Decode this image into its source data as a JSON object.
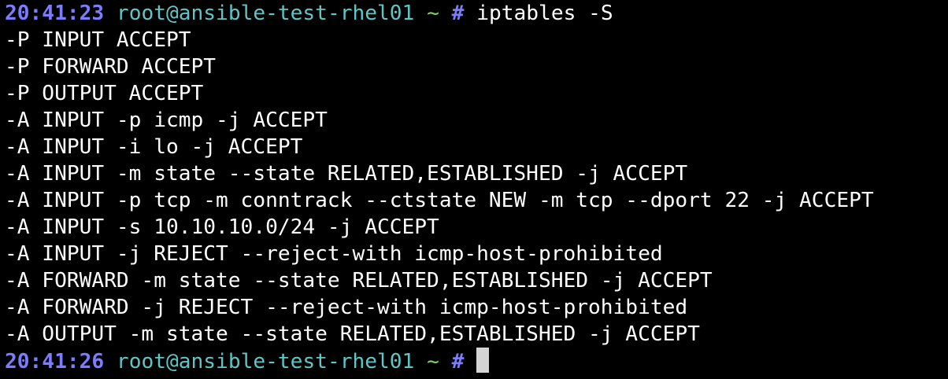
{
  "colors": {
    "background": "#000000",
    "foreground": "#ffffff",
    "time": "#7c7cff",
    "userhost": "#5ec6c6",
    "cwd": "#7fd26b",
    "cursor": "#d4d4d4"
  },
  "prompt1": {
    "time": "20:41:23",
    "userhost": "root@ansible-test-rhel01",
    "cwd": "~",
    "symbol": "#",
    "command": "iptables -S"
  },
  "output": [
    "-P INPUT ACCEPT",
    "-P FORWARD ACCEPT",
    "-P OUTPUT ACCEPT",
    "-A INPUT -p icmp -j ACCEPT",
    "-A INPUT -i lo -j ACCEPT",
    "-A INPUT -m state --state RELATED,ESTABLISHED -j ACCEPT",
    "-A INPUT -p tcp -m conntrack --ctstate NEW -m tcp --dport 22 -j ACCEPT",
    "-A INPUT -s 10.10.10.0/24 -j ACCEPT",
    "-A INPUT -j REJECT --reject-with icmp-host-prohibited",
    "-A FORWARD -m state --state RELATED,ESTABLISHED -j ACCEPT",
    "-A FORWARD -j REJECT --reject-with icmp-host-prohibited",
    "-A OUTPUT -m state --state RELATED,ESTABLISHED -j ACCEPT"
  ],
  "prompt2": {
    "time": "20:41:26",
    "userhost": "root@ansible-test-rhel01",
    "cwd": "~",
    "symbol": "#",
    "command": ""
  }
}
